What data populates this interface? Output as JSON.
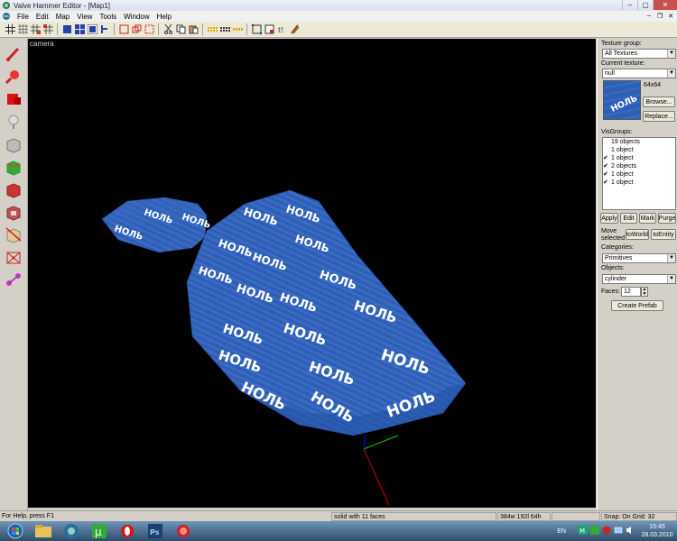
{
  "window": {
    "title": "Valve Hammer Editor - [Map1]"
  },
  "menu": [
    "File",
    "Edit",
    "Map",
    "View",
    "Tools",
    "Window",
    "Help"
  ],
  "viewport": {
    "label": "camera",
    "texture_text": "НОЛЬ"
  },
  "right_panel": {
    "texture_group_label": "Texture group:",
    "texture_group_value": "All Textures",
    "current_texture_label": "Current texture:",
    "current_texture_value": "null",
    "texture_size": "64x64",
    "browse": "Browse...",
    "replace": "Replace...",
    "visgroups_label": "VisGroups:",
    "visgroups": [
      "19 objects",
      "1 object",
      "1 object",
      "2 objects",
      "1 object",
      "1 object"
    ],
    "apply": "Apply",
    "edit": "Edit",
    "mark": "Mark",
    "purge": "Purge",
    "move_selected": "Move selected",
    "to_world": "toWorld",
    "to_entity": "toEntity",
    "categories_label": "Categories:",
    "categories_value": "Primitives",
    "objects_label": "Objects:",
    "objects_value": "cylinder",
    "faces_label": "Faces:",
    "faces_value": "12",
    "create_prefab": "Create Prefab"
  },
  "status": {
    "help": "For Help, press F1",
    "selection": "solid with 11 faces",
    "size": "384w 192l 64h",
    "snap": "Snap: On Grid: 32"
  },
  "taskbar": {
    "lang": "EN",
    "time": "15:45",
    "date": "28.03.2010",
    "ps": "Ps"
  },
  "colors": {
    "viewport_bg": "#000000",
    "texture_blue": "#2f5fb5",
    "taskbar": "#3c5f84"
  }
}
